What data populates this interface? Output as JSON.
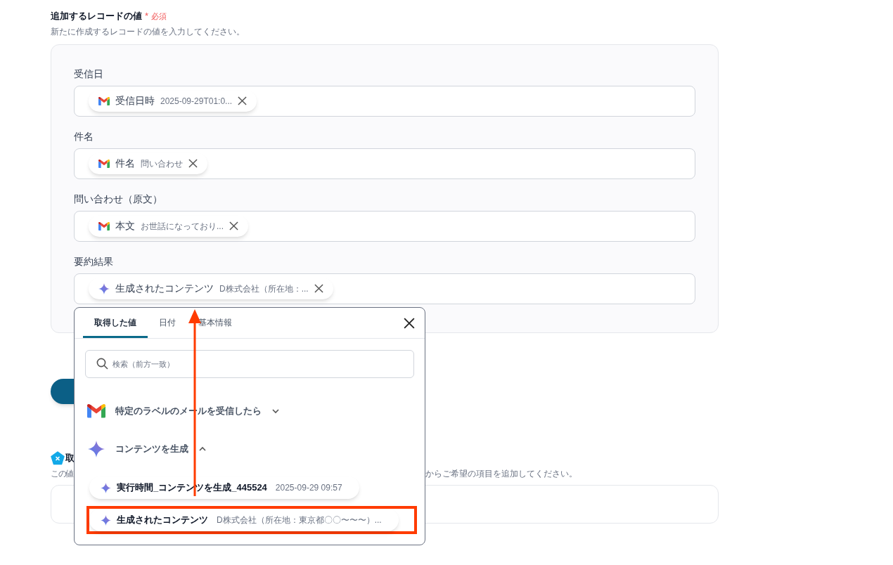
{
  "header": {
    "title": "追加するレコードの値",
    "required_mark": "*",
    "required": "必須",
    "description": "新たに作成するレコードの値を入力してください。"
  },
  "fields": [
    {
      "label": "受信日",
      "chip": {
        "kind": "gmail",
        "label": "受信日時",
        "value": "2025-09-29T01:0..."
      }
    },
    {
      "label": "件名",
      "chip": {
        "kind": "gmail",
        "label": "件名",
        "value": "問い合わせ"
      }
    },
    {
      "label": "問い合わせ（原文）",
      "chip": {
        "kind": "gmail",
        "label": "本文",
        "value": "お世話になっており..."
      }
    },
    {
      "label": "要約結果",
      "chip": {
        "kind": "gemini",
        "label": "生成されたコンテンツ",
        "value": "D株式会社（所在地：..."
      }
    }
  ],
  "next_section": {
    "title": "取",
    "description_start": "この値",
    "description_end": "からご希望の項目を追加してください。"
  },
  "popup": {
    "tabs": [
      {
        "label": "取得した値",
        "selected": true
      },
      {
        "label": "日付",
        "selected": false
      },
      {
        "label": "基本情報",
        "selected": false
      }
    ],
    "search": {
      "placeholder": "検索（前方一致）"
    },
    "groups": [
      {
        "kind": "gmail",
        "title": "特定のラベルのメールを受信したら",
        "expanded": false
      },
      {
        "kind": "gemini",
        "title": "コンテンツを生成",
        "expanded": true,
        "children": [
          {
            "label": "実行時間_コンテンツを生成_445524",
            "value": "2025-09-29 09:57",
            "highlighted": false
          },
          {
            "label": "生成されたコンテンツ",
            "value": "D株式会社（所在地：東京都〇〇〜〜〜）...",
            "highlighted": true
          }
        ]
      }
    ]
  }
}
